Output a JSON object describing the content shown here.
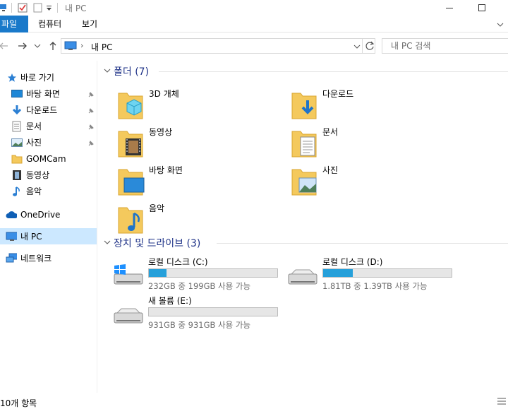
{
  "window": {
    "title": "내 PC"
  },
  "ribbon": {
    "tabs": [
      "파일",
      "컴퓨터",
      "보기"
    ]
  },
  "address": {
    "path_label": "내 PC",
    "search_placeholder": "내 PC 검색"
  },
  "sidebar": {
    "quick_access": "바로 가기",
    "items": [
      {
        "label": "바탕 화면",
        "icon": "desktop-icon",
        "pinned": true
      },
      {
        "label": "다운로드",
        "icon": "download-icon",
        "pinned": true
      },
      {
        "label": "문서",
        "icon": "document-icon",
        "pinned": true
      },
      {
        "label": "사진",
        "icon": "pictures-icon",
        "pinned": true
      },
      {
        "label": "GOMCam",
        "icon": "folder-icon",
        "pinned": false
      },
      {
        "label": "동영상",
        "icon": "video-icon",
        "pinned": false
      },
      {
        "label": "음악",
        "icon": "music-icon",
        "pinned": false
      }
    ],
    "onedrive": "OneDrive",
    "this_pc": "내 PC",
    "network": "네트워크"
  },
  "folders": {
    "header": "폴더 (7)",
    "items": [
      "3D 개체",
      "다운로드",
      "동영상",
      "문서",
      "바탕 화면",
      "사진",
      "음악"
    ]
  },
  "drives": {
    "header": "장치 및 드라이브 (3)",
    "items": [
      {
        "name": "로컬 디스크 (C:)",
        "free": "232GB 중 199GB 사용 가능",
        "used_fraction": 0.14,
        "icon": "windows-drive-icon"
      },
      {
        "name": "로컬 디스크 (D:)",
        "free": "1.81TB 중 1.39TB 사용 가능",
        "used_fraction": 0.23,
        "icon": "hard-drive-icon"
      },
      {
        "name": "새 볼륨 (E:)",
        "free": "931GB 중 931GB 사용 가능",
        "used_fraction": 0.0,
        "icon": "hard-drive-icon"
      }
    ]
  },
  "status": {
    "count": "10개 항목"
  },
  "colors": {
    "accent": "#1979ca",
    "bar_fill": "#26a0da",
    "selected": "#cce8ff",
    "header_text": "#1e3287"
  }
}
